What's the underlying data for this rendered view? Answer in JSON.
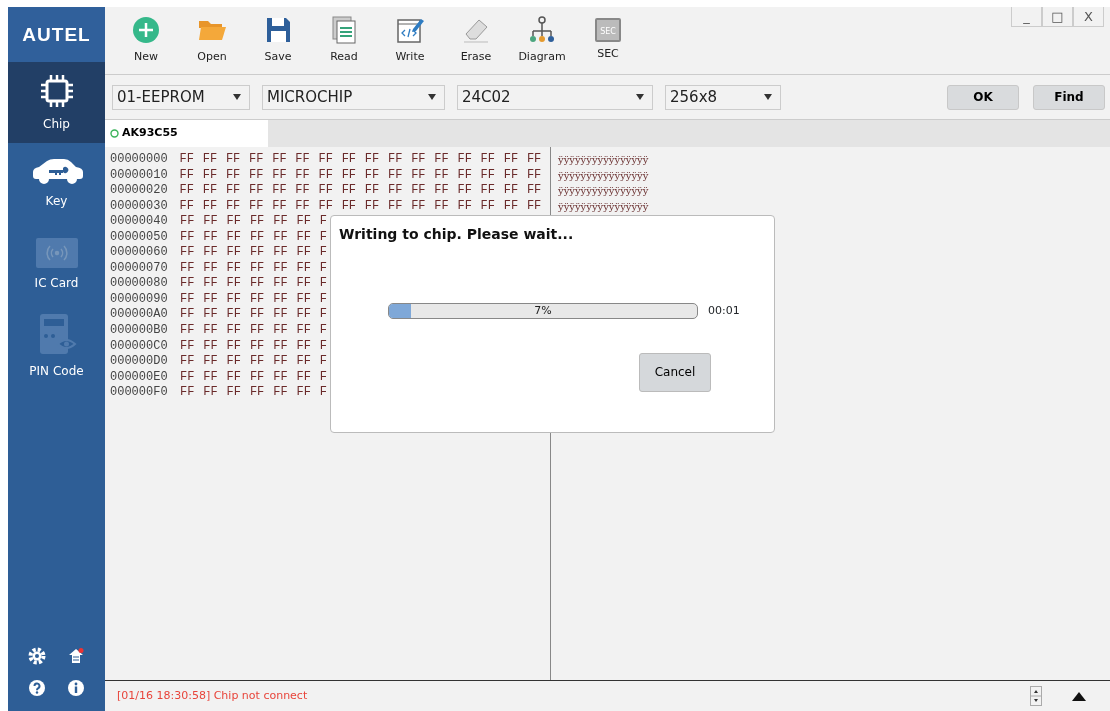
{
  "window": {
    "controls": [
      "_",
      "□",
      "X"
    ]
  },
  "sidebar": {
    "logo": "AUTEL",
    "items": [
      {
        "kind": "chip",
        "label": "Chip",
        "selected": true,
        "disabled": false
      },
      {
        "kind": "key",
        "label": "Key",
        "selected": false,
        "disabled": false
      },
      {
        "kind": "card",
        "label": "IC Card",
        "selected": false,
        "disabled": true
      },
      {
        "kind": "pin",
        "label": "PIN Code",
        "selected": false,
        "disabled": true
      }
    ],
    "footer_icons": [
      {
        "kind": "settings"
      },
      {
        "kind": "home"
      },
      {
        "kind": "help"
      },
      {
        "kind": "info"
      }
    ]
  },
  "toolbar": [
    {
      "kind": "new",
      "label": "New"
    },
    {
      "kind": "open",
      "label": "Open"
    },
    {
      "kind": "save",
      "label": "Save"
    },
    {
      "kind": "read",
      "label": "Read"
    },
    {
      "kind": "write",
      "label": "Write"
    },
    {
      "kind": "erase",
      "label": "Erase"
    },
    {
      "kind": "diagram",
      "label": "Diagram"
    },
    {
      "kind": "sec",
      "label": "SEC",
      "icon_text": "SEC"
    }
  ],
  "selectors": [
    {
      "value": "01-EEPROM"
    },
    {
      "value": "MICROCHIP"
    },
    {
      "value": "24C02"
    },
    {
      "value": "256x8"
    }
  ],
  "buttons": [
    "OK",
    "Find"
  ],
  "tabs": [
    {
      "label": "AK93C55",
      "selected": true
    }
  ],
  "hex": {
    "rows": [
      {
        "address": "00000000",
        "bytes": [
          "FF",
          "FF",
          "FF",
          "FF",
          "FF",
          "FF",
          "FF",
          "FF",
          "FF",
          "FF",
          "FF",
          "FF",
          "FF",
          "FF",
          "FF",
          "FF"
        ],
        "ascii": "ÿÿÿÿÿÿÿÿÿÿÿÿÿÿÿÿ"
      },
      {
        "address": "00000010",
        "bytes": [
          "FF",
          "FF",
          "FF",
          "FF",
          "FF",
          "FF",
          "FF",
          "FF",
          "FF",
          "FF",
          "FF",
          "FF",
          "FF",
          "FF",
          "FF",
          "FF"
        ],
        "ascii": "ÿÿÿÿÿÿÿÿÿÿÿÿÿÿÿÿ"
      },
      {
        "address": "00000020",
        "bytes": [
          "FF",
          "FF",
          "FF",
          "FF",
          "FF",
          "FF",
          "FF",
          "FF",
          "FF",
          "FF",
          "FF",
          "FF",
          "FF",
          "FF",
          "FF",
          "FF"
        ],
        "ascii": "ÿÿÿÿÿÿÿÿÿÿÿÿÿÿÿÿ"
      },
      {
        "address": "00000030",
        "bytes": [
          "FF",
          "FF",
          "FF",
          "FF",
          "FF",
          "FF",
          "FF",
          "FF",
          "FF",
          "FF",
          "FF",
          "FF",
          "FF",
          "FF",
          "FF",
          "FF"
        ],
        "ascii": "ÿÿÿÿÿÿÿÿÿÿÿÿÿÿÿÿ"
      },
      {
        "address": "00000040",
        "bytes": [
          "FF",
          "FF",
          "FF",
          "FF",
          "FF",
          "FF",
          "F"
        ]
      },
      {
        "address": "00000050",
        "bytes": [
          "FF",
          "FF",
          "FF",
          "FF",
          "FF",
          "FF",
          "F"
        ]
      },
      {
        "address": "00000060",
        "bytes": [
          "FF",
          "FF",
          "FF",
          "FF",
          "FF",
          "FF",
          "F"
        ]
      },
      {
        "address": "00000070",
        "bytes": [
          "FF",
          "FF",
          "FF",
          "FF",
          "FF",
          "FF",
          "F"
        ]
      },
      {
        "address": "00000080",
        "bytes": [
          "FF",
          "FF",
          "FF",
          "FF",
          "FF",
          "FF",
          "F"
        ]
      },
      {
        "address": "00000090",
        "bytes": [
          "FF",
          "FF",
          "FF",
          "FF",
          "FF",
          "FF",
          "F"
        ]
      },
      {
        "address": "000000A0",
        "bytes": [
          "FF",
          "FF",
          "FF",
          "FF",
          "FF",
          "FF",
          "F"
        ]
      },
      {
        "address": "000000B0",
        "bytes": [
          "FF",
          "FF",
          "FF",
          "FF",
          "FF",
          "FF",
          "F"
        ]
      },
      {
        "address": "000000C0",
        "bytes": [
          "FF",
          "FF",
          "FF",
          "FF",
          "FF",
          "FF",
          "F"
        ]
      },
      {
        "address": "000000D0",
        "bytes": [
          "FF",
          "FF",
          "FF",
          "FF",
          "FF",
          "FF",
          "F"
        ]
      },
      {
        "address": "000000E0",
        "bytes": [
          "FF",
          "FF",
          "FF",
          "FF",
          "FF",
          "FF",
          "F"
        ]
      },
      {
        "address": "000000F0",
        "bytes": [
          "FF",
          "FF",
          "FF",
          "FF",
          "FF",
          "FF",
          "F"
        ]
      }
    ]
  },
  "dialog": {
    "title": "Writing to chip. Please wait...",
    "progress": {
      "level": 0.07,
      "reading": "7%"
    },
    "elapsed": "00:01",
    "button": "Cancel"
  },
  "status_bar": {
    "message": "[01/16 18:30:58] Chip not connect",
    "color": "#e8443a"
  }
}
